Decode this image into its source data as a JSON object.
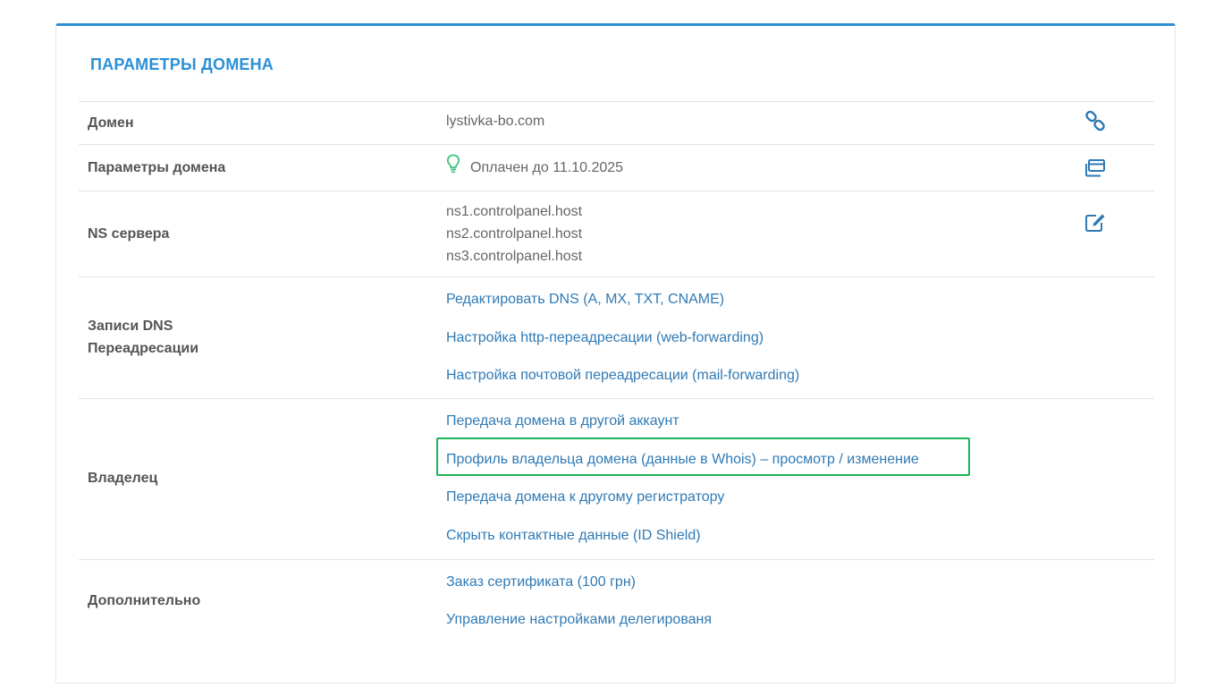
{
  "panel": {
    "title": "ПАРАМЕТРЫ ДОМЕНА"
  },
  "rows": {
    "domain": {
      "label": "Домен",
      "value": "lystivka-bo.com",
      "action_icon": "link-icon"
    },
    "params": {
      "label": "Параметры домена",
      "status_icon": "lightbulb-icon",
      "value": "Оплачен до 11.10.2025",
      "action_icon": "cards-icon"
    },
    "ns": {
      "label": "NS сервера",
      "servers": [
        "ns1.controlpanel.host",
        "ns2.controlpanel.host",
        "ns3.controlpanel.host"
      ],
      "action_icon": "edit-icon"
    },
    "dns": {
      "label_line1": "Записи DNS",
      "label_line2": "Переадресации",
      "links": [
        "Редактировать DNS (A, MX, TXT, CNAME)",
        "Настройка http-переадресации (web-forwarding)",
        "Настройка почтовой переадресации (mail-forwarding)"
      ]
    },
    "owner": {
      "label": "Владелец",
      "links": [
        "Передача домена в другой аккаунт",
        "Профиль владельца домена (данные в Whois) – просмотр / изменение",
        "Передача домена к другому регистратору",
        "Скрыть контактные данные (ID Shield)"
      ]
    },
    "extra": {
      "label": "Дополнительно",
      "links": [
        "Заказ сертификата (100 грн)",
        "Управление настройками делегированя"
      ]
    }
  },
  "colors": {
    "accent": "#2b8fd6",
    "link": "#2f7ab5",
    "highlight": "#1cb35a",
    "status_green": "#3cc47c"
  }
}
